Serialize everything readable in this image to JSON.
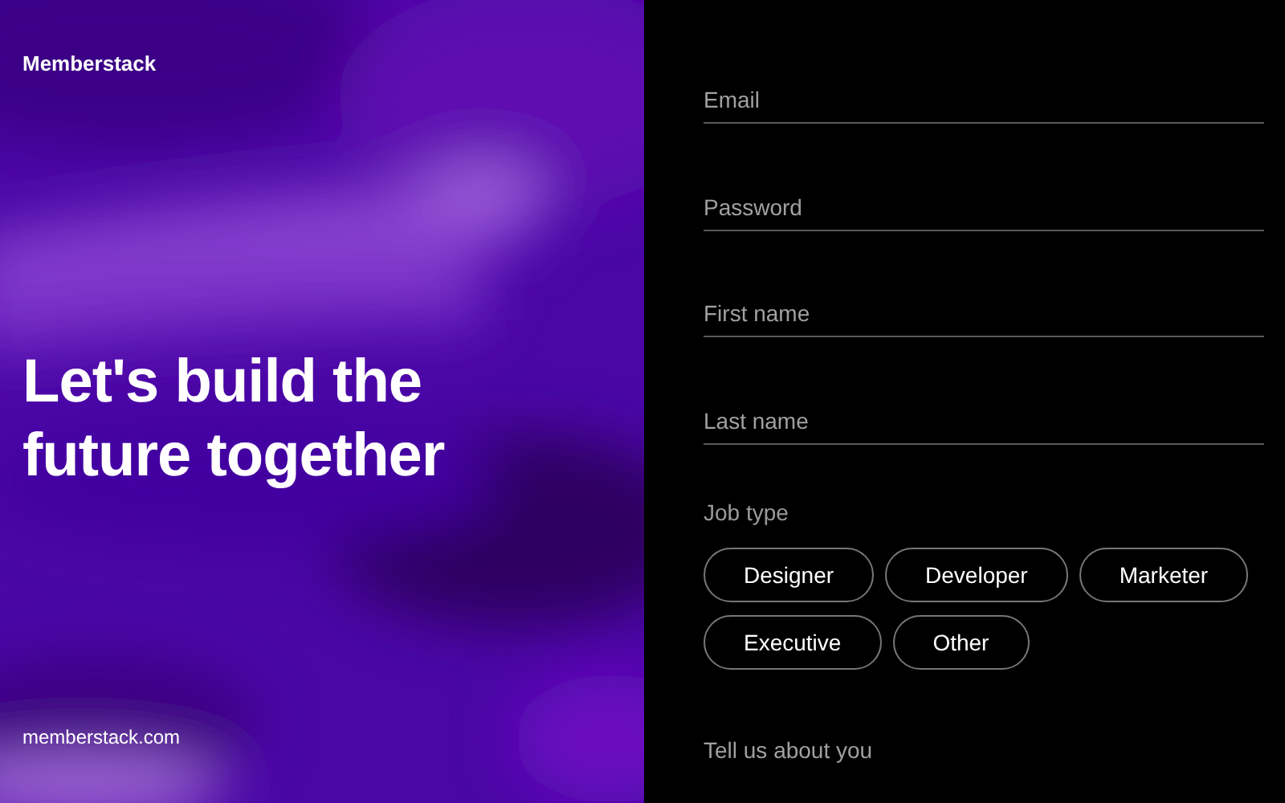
{
  "brand": "Memberstack",
  "headline": "Let's build the future together",
  "website": "memberstack.com",
  "fields": [
    {
      "placeholder": "Email"
    },
    {
      "placeholder": "Password"
    },
    {
      "placeholder": "First name"
    },
    {
      "placeholder": "Last name"
    }
  ],
  "job_type": {
    "label": "Job type",
    "options": [
      {
        "label": "Designer",
        "selected": false
      },
      {
        "label": "Developer",
        "selected": false
      },
      {
        "label": "Marketer",
        "selected": false
      },
      {
        "label": "Executive",
        "selected": false
      },
      {
        "label": "Other",
        "selected": false
      }
    ]
  },
  "about": {
    "placeholder": "Tell us about you"
  }
}
